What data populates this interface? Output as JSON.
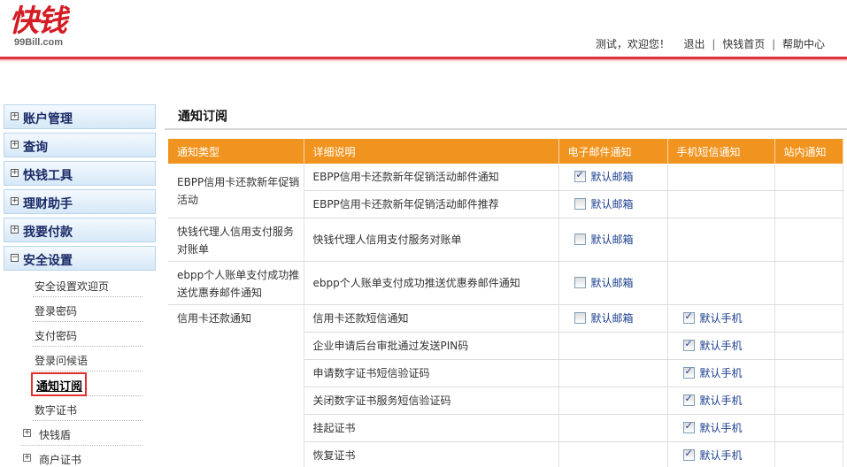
{
  "logo": {
    "main": "快钱",
    "sub": "99Bill.com"
  },
  "topnav": {
    "greeting": "测试，欢迎您！",
    "logout": "退出",
    "home": "快钱首页",
    "help": "帮助中心"
  },
  "sidebar": {
    "sections": [
      {
        "label": "账户管理",
        "toggle": "+"
      },
      {
        "label": "查询",
        "toggle": "+"
      },
      {
        "label": "快钱工具",
        "toggle": "+"
      },
      {
        "label": "理财助手",
        "toggle": "+"
      },
      {
        "label": "我要付款",
        "toggle": "+"
      },
      {
        "label": "安全设置",
        "toggle": "−"
      }
    ],
    "security_items": [
      {
        "label": "安全设置欢迎页"
      },
      {
        "label": "登录密码"
      },
      {
        "label": "支付密码"
      },
      {
        "label": "登录问候语"
      },
      {
        "label": "通知订阅"
      },
      {
        "label": "数字证书"
      },
      {
        "label": "快钱盾",
        "toggle": "+"
      },
      {
        "label": "商户证书",
        "toggle": "+"
      }
    ]
  },
  "main": {
    "title": "通知订阅",
    "columns": [
      "通知类型",
      "详细说明",
      "电子邮件通知",
      "手机短信通知",
      "站内通知"
    ],
    "default_email": "默认邮箱",
    "default_phone": "默认手机",
    "rows": [
      {
        "type": "EBPP信用卡还款新年促销活动",
        "detail": "EBPP信用卡还款新年促销活动邮件通知",
        "email": true,
        "phone": null
      },
      {
        "type": "",
        "detail": "EBPP信用卡还款新年促销活动邮件推荐",
        "email": false,
        "phone": null
      },
      {
        "type": "快钱代理人信用支付服务对账单",
        "detail": "快钱代理人信用支付服务对账单",
        "email": false,
        "phone": null
      },
      {
        "type": "ebpp个人账单支付成功推送优惠券邮件通知",
        "detail": "ebpp个人账单支付成功推送优惠券邮件通知",
        "email": false,
        "phone": null
      },
      {
        "type": "信用卡还款通知",
        "detail": "信用卡还款短信通知",
        "email": false,
        "phone": true
      },
      {
        "type": "",
        "detail": "企业申请后台审批通过发送PIN码",
        "email": null,
        "phone": true
      },
      {
        "type": "",
        "detail": "申请数字证书短信验证码",
        "email": null,
        "phone": true
      },
      {
        "type": "",
        "detail": "关闭数字证书服务短信验证码",
        "email": null,
        "phone": true
      },
      {
        "type": "",
        "detail": "挂起证书",
        "email": null,
        "phone": true
      },
      {
        "type": "",
        "detail": "恢复证书",
        "email": null,
        "phone": true
      }
    ]
  }
}
